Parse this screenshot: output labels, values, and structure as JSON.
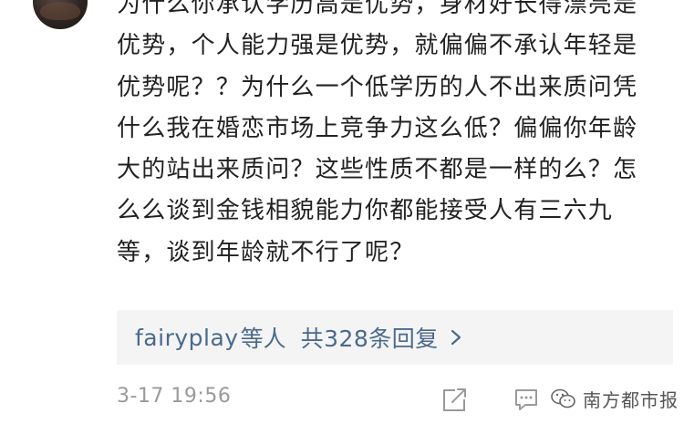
{
  "comment": {
    "text": "为什么你承认学历高是优势，身材好长得漂亮是优势，个人能力强是优势，就偏偏不承认年轻是优势呢？？为什么一个低学历的人不出来质问凭什么我在婚恋市场上竞争力这么低？偏偏你年龄大的站出来质问？这些性质不都是一样的么？怎么么谈到金钱相貌能力你都能接受人有三六九等，谈到年龄就不行了呢？"
  },
  "replies": {
    "user": "fairyplay",
    "suffix": "等人",
    "count_label": "共328条回复",
    "chevron_icon": "chevron-right-icon"
  },
  "meta": {
    "timestamp": "3-17 19:56"
  },
  "actions": {
    "share_icon": "share-icon",
    "comment_icon": "comment-icon"
  },
  "watermark": {
    "text": "南方都市报",
    "logo_icon": "wechat-icon"
  },
  "colors": {
    "link": "#4a6a8c",
    "muted": "#9a9a9a",
    "body": "#222222",
    "reply_bg": "#f4f4f4"
  }
}
